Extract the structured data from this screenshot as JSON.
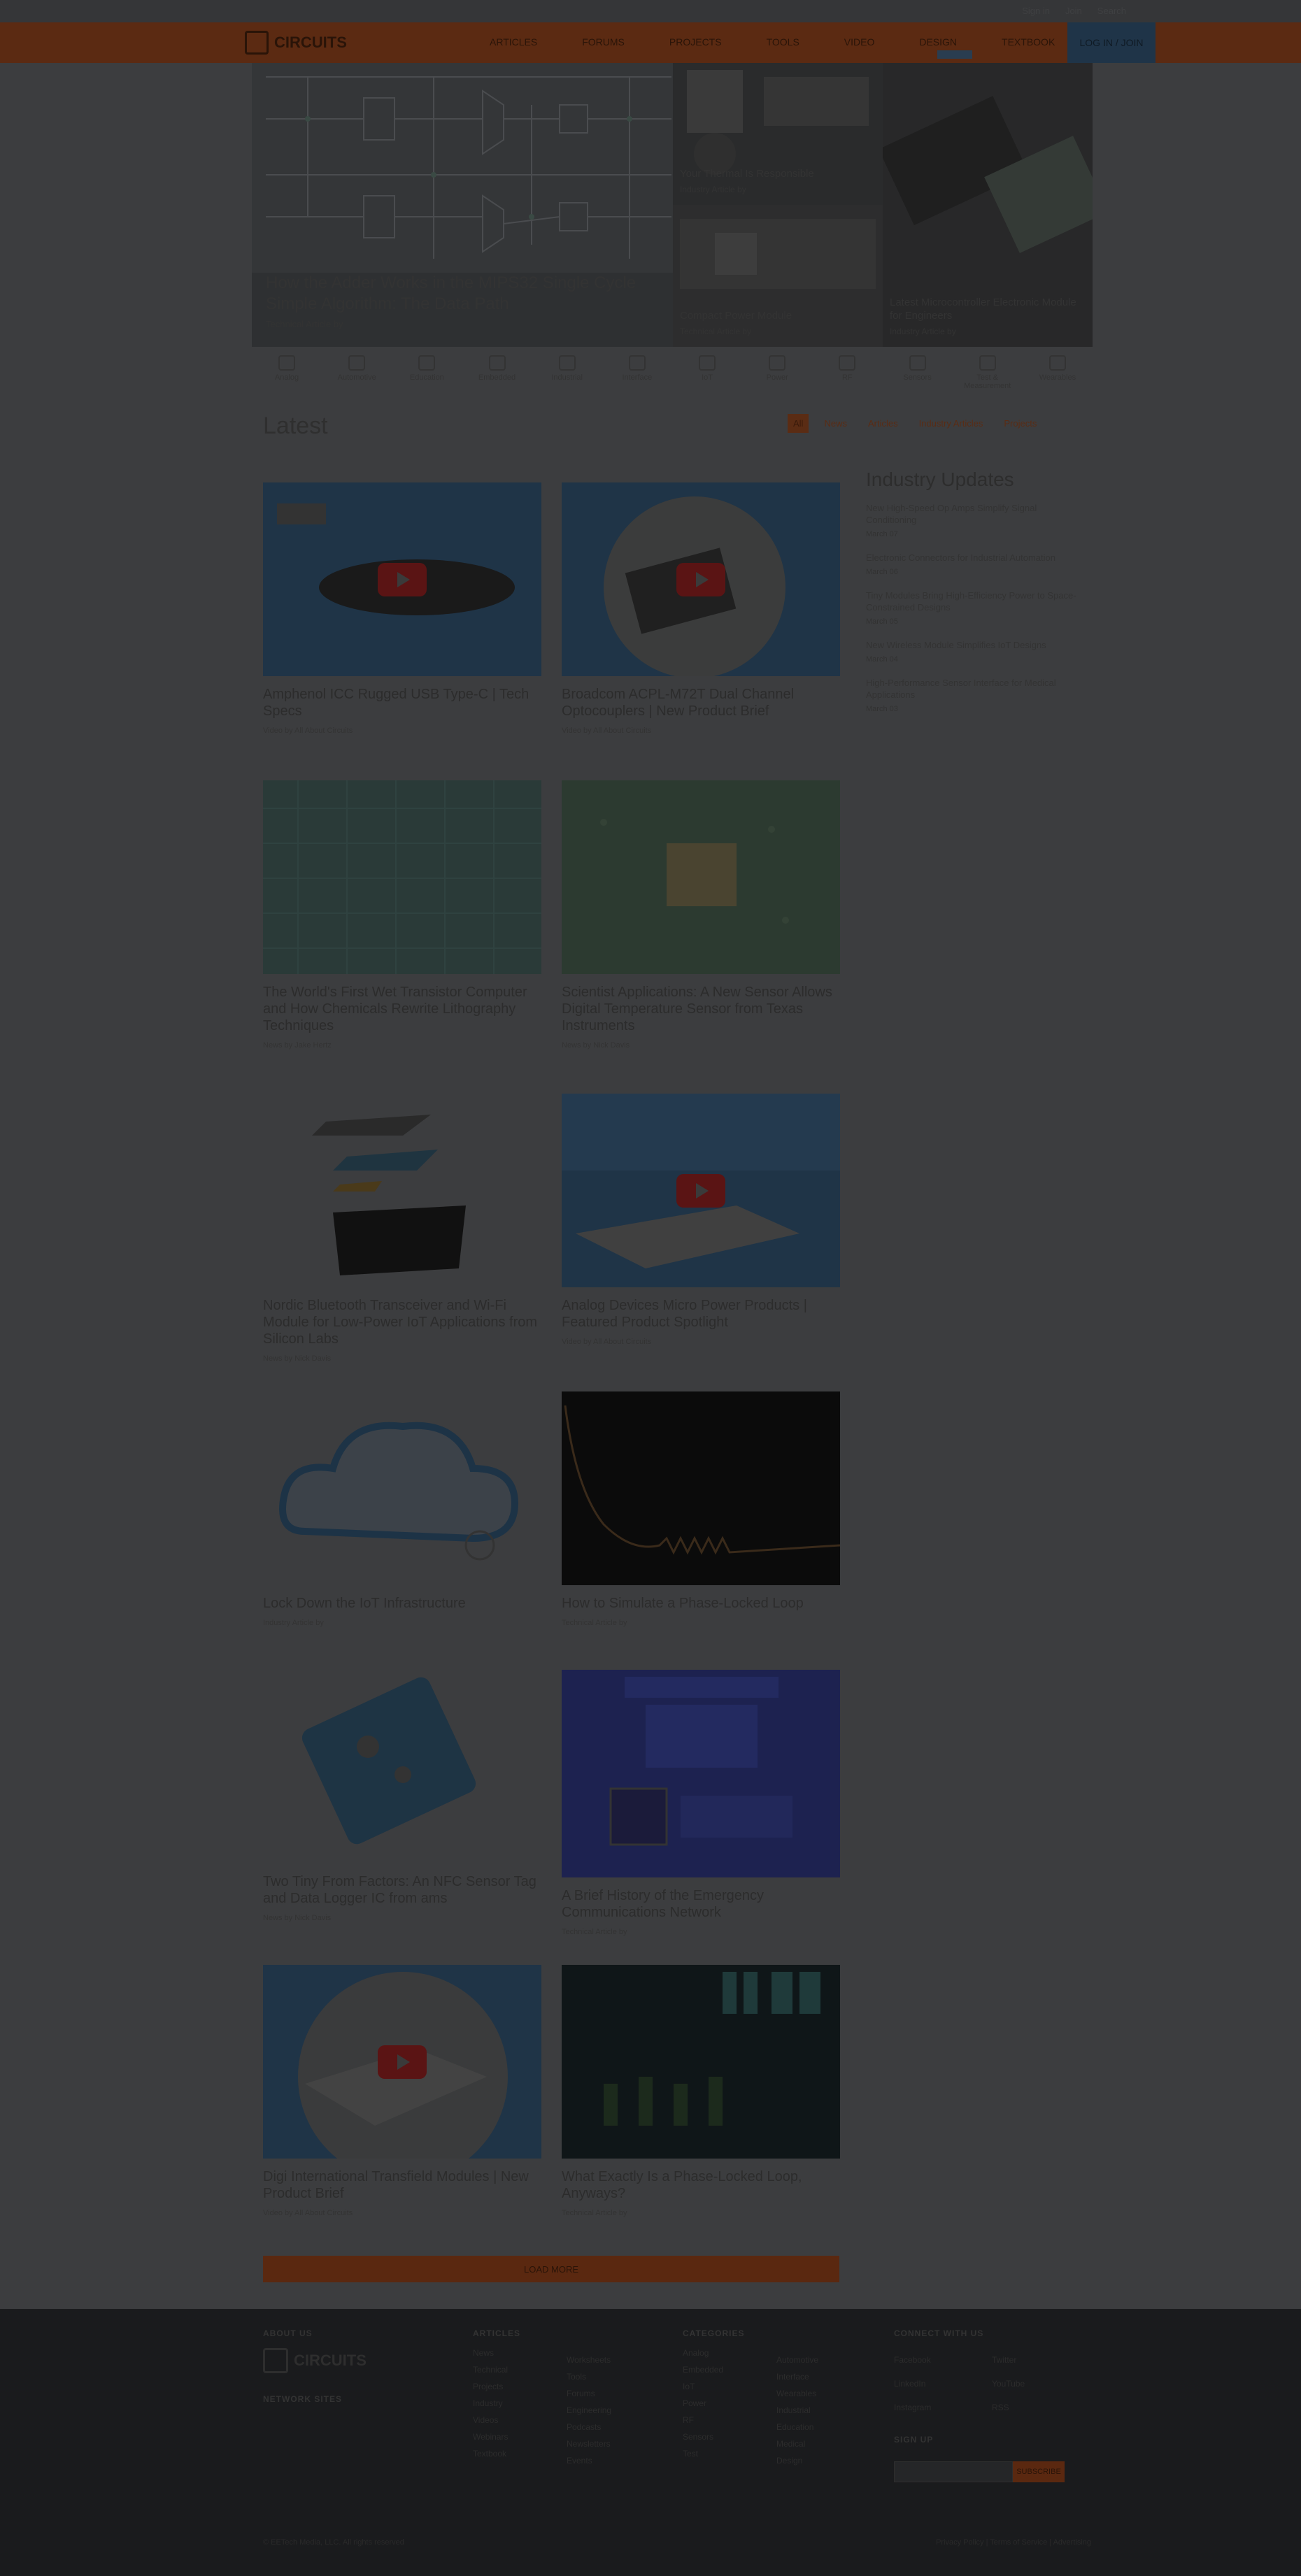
{
  "topbar": {
    "links": [
      "Sign in",
      "Join",
      "Search"
    ]
  },
  "nav": {
    "logo_text": "CIRCUITS",
    "items": [
      "ARTICLES",
      "FORUMS",
      "PROJECTS",
      "TOOLS",
      "VIDEO",
      "DESIGN",
      "TEXTBOOK"
    ],
    "login_label": "LOG IN / JOIN"
  },
  "hero": {
    "main": {
      "title": "How the Adder Works in the MIPS32 Single Cycle Simple Algorithm: The Data Path",
      "meta": "Technical Article by"
    },
    "tiles": [
      {
        "title": "Your Thermal Is Responsible",
        "meta": "Industry Article by"
      },
      {
        "title": "Compact Power Module",
        "meta": "Technical Article by"
      },
      {
        "title": "Coming of the Cheapest Electronics",
        "meta": "Industry Article by"
      },
      {
        "title": "Latest Microcontroller Electronic Module for Engineers",
        "meta": "Industry Article by"
      }
    ]
  },
  "categories": [
    "Analog",
    "Automotive",
    "Education",
    "Embedded",
    "Industrial",
    "Interface",
    "IoT",
    "Power",
    "RF",
    "Sensors",
    "Test & Measurement",
    "Wearables"
  ],
  "latest": {
    "title": "Latest",
    "tabs": [
      "All",
      "News",
      "Articles",
      "Industry Articles",
      "Projects"
    ],
    "active_tab": "All"
  },
  "cards": [
    {
      "title": "Amphenol ICC Rugged USB Type-C | Tech Specs",
      "meta": "Video by All About Circuits"
    },
    {
      "title": "Broadcom ACPL-M72T Dual Channel Optocouplers | New Product Brief",
      "meta": "Video by All About Circuits"
    },
    {
      "title": "The World's First Wet Transistor Computer and How Chemicals Rewrite Lithography Techniques",
      "meta": "News by Jake Hertz"
    },
    {
      "title": "Scientist Applications: A New Sensor Allows Digital Temperature Sensor from Texas Instruments",
      "meta": "News by Nick Davis"
    },
    {
      "title": "Nordic Bluetooth Transceiver and Wi-Fi Module for Low-Power IoT Applications from Silicon Labs",
      "meta": "News by Nick Davis"
    },
    {
      "title": "Analog Devices Micro Power Products | Featured Product Spotlight",
      "meta": "Video by All About Circuits"
    },
    {
      "title": "Lock Down the IoT Infrastructure",
      "meta": "Industry Article by"
    },
    {
      "title": "How to Simulate a Phase-Locked Loop",
      "meta": "Technical Article by"
    },
    {
      "title": "Two Tiny From Factors: An NFC Sensor Tag and Data Logger IC from ams",
      "meta": "News by Nick Davis"
    },
    {
      "title": "A Brief History of the Emergency Communications Network",
      "meta": "Technical Article by"
    },
    {
      "title": "Digi International Transfield Modules | New Product Brief",
      "meta": "Video by All About Circuits"
    },
    {
      "title": "What Exactly Is a Phase-Locked Loop, Anyways?",
      "meta": "Technical Article by"
    }
  ],
  "sidebar": {
    "title": "Industry Updates",
    "items": [
      {
        "text": "New High-Speed Op Amps Simplify Signal Conditioning",
        "date": "March 07"
      },
      {
        "text": "Electronic Connectors for Industrial Automation",
        "date": "March 06"
      },
      {
        "text": "Tiny Modules Bring High-Efficiency Power to Space-Constrained Designs",
        "date": "March 05"
      },
      {
        "text": "New Wireless Module Simplifies IoT Designs",
        "date": "March 04"
      },
      {
        "text": "High-Performance Sensor Interface for Medical Applications",
        "date": "March 03"
      }
    ]
  },
  "load_more": "LOAD MORE",
  "footer": {
    "about_heading": "ABOUT US",
    "logo_text": "CIRCUITS",
    "network_heading": "NETWORK SITES",
    "col_articles": {
      "heading": "ARTICLES",
      "links": [
        "News",
        "Technical",
        "Projects",
        "Industry",
        "Videos",
        "Webinars",
        "Textbook"
      ]
    },
    "col_more": {
      "links": [
        "Worksheets",
        "Tools",
        "Forums",
        "Engineering",
        "Podcasts",
        "Newsletters",
        "Events"
      ]
    },
    "col_categories": {
      "heading": "CATEGORIES",
      "links": [
        "Analog",
        "Embedded",
        "IoT",
        "Power",
        "RF",
        "Sensors",
        "Test"
      ]
    },
    "col_cat_more": {
      "links": [
        "Automotive",
        "Interface",
        "Wearables",
        "Industrial",
        "Education",
        "Medical",
        "Design"
      ]
    },
    "col_connect": {
      "heading": "CONNECT WITH US",
      "links": [
        "Facebook",
        "Twitter",
        "LinkedIn",
        "YouTube",
        "Instagram",
        "RSS"
      ]
    },
    "signup_heading": "SIGN UP",
    "signup_button": "SUBSCRIBE",
    "copyright": "© EETech Media, LLC. All rights reserved",
    "policy": "Privacy Policy | Terms of Service | Advertising"
  },
  "colors": {
    "overlay_bg": "#3c3d3f",
    "nav_accent": "#5b2a12",
    "login_bg": "#1f3448",
    "footer_bg": "#1a1b1d"
  }
}
